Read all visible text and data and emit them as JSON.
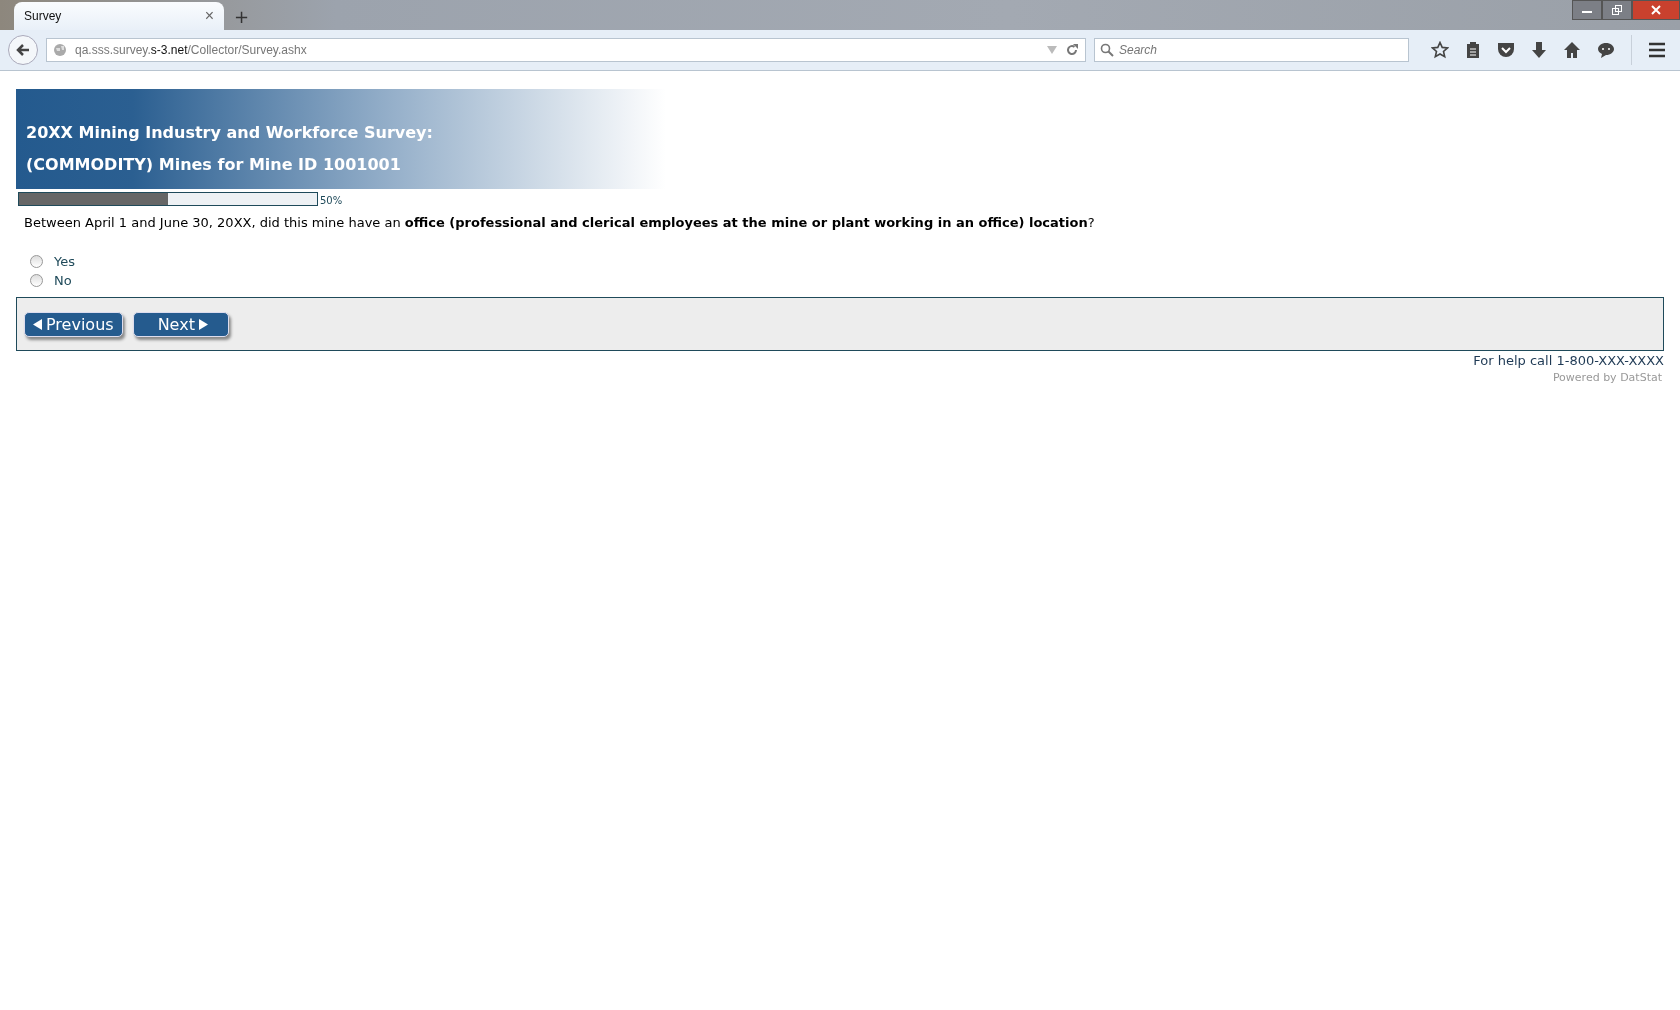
{
  "browser": {
    "tab": {
      "title": "Survey",
      "close": "×",
      "selected": true
    },
    "new_tab": "+",
    "url": {
      "prefix": "qa.sss.survey.",
      "domain": "s-3.net",
      "path": "/Collector/Survey.ashx"
    },
    "search": {
      "placeholder": "Search"
    }
  },
  "survey": {
    "title_lines": [
      "20XX Mining Industry and Workforce Survey:",
      "(COMMODITY) Mines for Mine ID 1001001"
    ],
    "progress": {
      "level": 0.5,
      "reading": "50%"
    },
    "question": "Between April 1 and June 30, 20XX, did this mine have an **office (professional and clerical employees at the mine or plant working in an office) location**?",
    "options": [
      {
        "label": "Yes",
        "selected": false
      },
      {
        "label": "No",
        "selected": false
      }
    ],
    "buttons": [
      {
        "kind": "previous",
        "label": "Previous"
      },
      {
        "kind": "next",
        "label": "Next"
      }
    ],
    "help": "For help call 1-800-XXX-XXXX",
    "powered": "Powered by DatStat"
  }
}
